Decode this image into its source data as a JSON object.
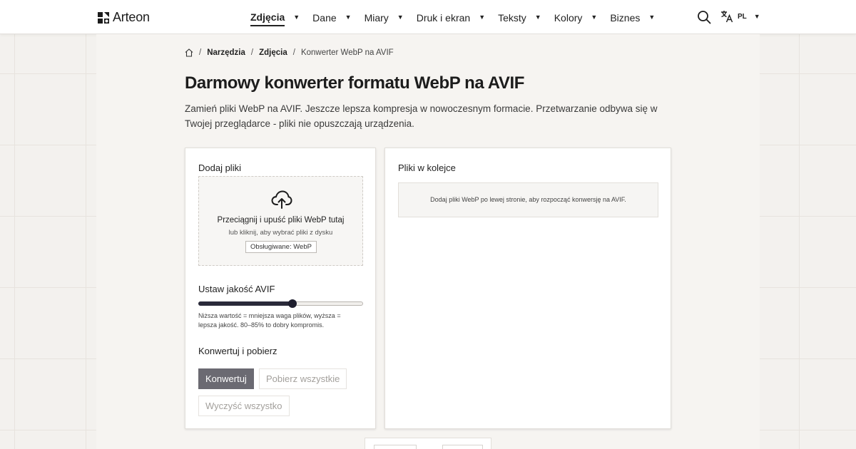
{
  "header": {
    "logo_text": "Arteon",
    "nav": [
      {
        "label": "Zdjęcia",
        "active": true
      },
      {
        "label": "Dane",
        "active": false
      },
      {
        "label": "Miary",
        "active": false
      },
      {
        "label": "Druk i ekran",
        "active": false
      },
      {
        "label": "Teksty",
        "active": false
      },
      {
        "label": "Kolory",
        "active": false
      },
      {
        "label": "Biznes",
        "active": false
      }
    ],
    "search_icon": "search-icon",
    "language": {
      "icon": "translate-icon",
      "code": "PL"
    }
  },
  "breadcrumb": {
    "home_icon": "home-icon",
    "items": [
      "Narzędzia",
      "Zdjęcia"
    ],
    "current": "Konwerter WebP na AVIF"
  },
  "page": {
    "title": "Darmowy konwerter formatu WebP na AVIF",
    "description": "Zamień pliki WebP na AVIF. Jeszcze lepsza kompresja w nowoczesnym formacie. Przetwarzanie odbywa się w Twojej przeglądarce - pliki nie opuszczają urządzenia."
  },
  "upload": {
    "section_title": "Dodaj pliki",
    "icon": "cloud-upload-icon",
    "title": "Przeciągnij i upuść pliki WebP tutaj",
    "subtitle": "lub kliknij, aby wybrać pliki z dysku",
    "supported": "Obsługiwane: WebP"
  },
  "quality": {
    "section_title": "Ustaw jakość AVIF",
    "value_fraction": 0.57,
    "hint": "Niższa wartość = mniejsza waga plików, wyższa = lepsza jakość. 80–85% to dobry kompromis."
  },
  "actions": {
    "section_title": "Konwertuj i pobierz",
    "convert": "Konwertuj",
    "download_all": "Pobierz wszystkie",
    "clear_all": "Wyczyść wszystko"
  },
  "queue": {
    "section_title": "Pliki w kolejce",
    "empty_message": "Dodaj pliki WebP po lewej stronie, aby rozpocząć konwersję na AVIF."
  },
  "colors": {
    "accent": "#2a2a3a",
    "convert_button": "#6b6a72",
    "page_background": "#f3f1ee"
  }
}
